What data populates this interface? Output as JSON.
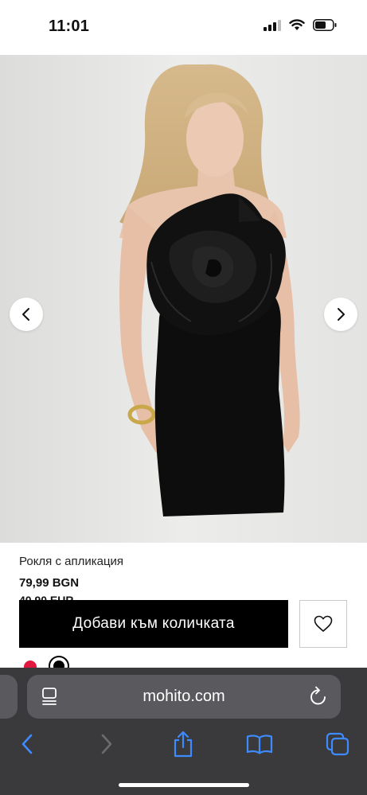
{
  "status_bar": {
    "time": "11:01"
  },
  "product": {
    "name": "Рокля с апликация",
    "price": "79,99 BGN",
    "price_alt": "40,90 EUR",
    "add_to_cart_label": "Добави към количката",
    "colors": [
      "#e0173e",
      "#000000"
    ],
    "selected_color_index": 1
  },
  "browser": {
    "url": "mohito.com"
  },
  "icons": {
    "prev": "chevron-left-icon",
    "next": "chevron-right-icon",
    "wishlist": "heart-icon",
    "reader": "reader-mode-icon",
    "reload": "reload-icon",
    "back": "back-icon",
    "forward": "forward-icon",
    "share": "share-icon",
    "bookmarks": "bookmarks-icon",
    "tabs": "tabs-icon"
  }
}
